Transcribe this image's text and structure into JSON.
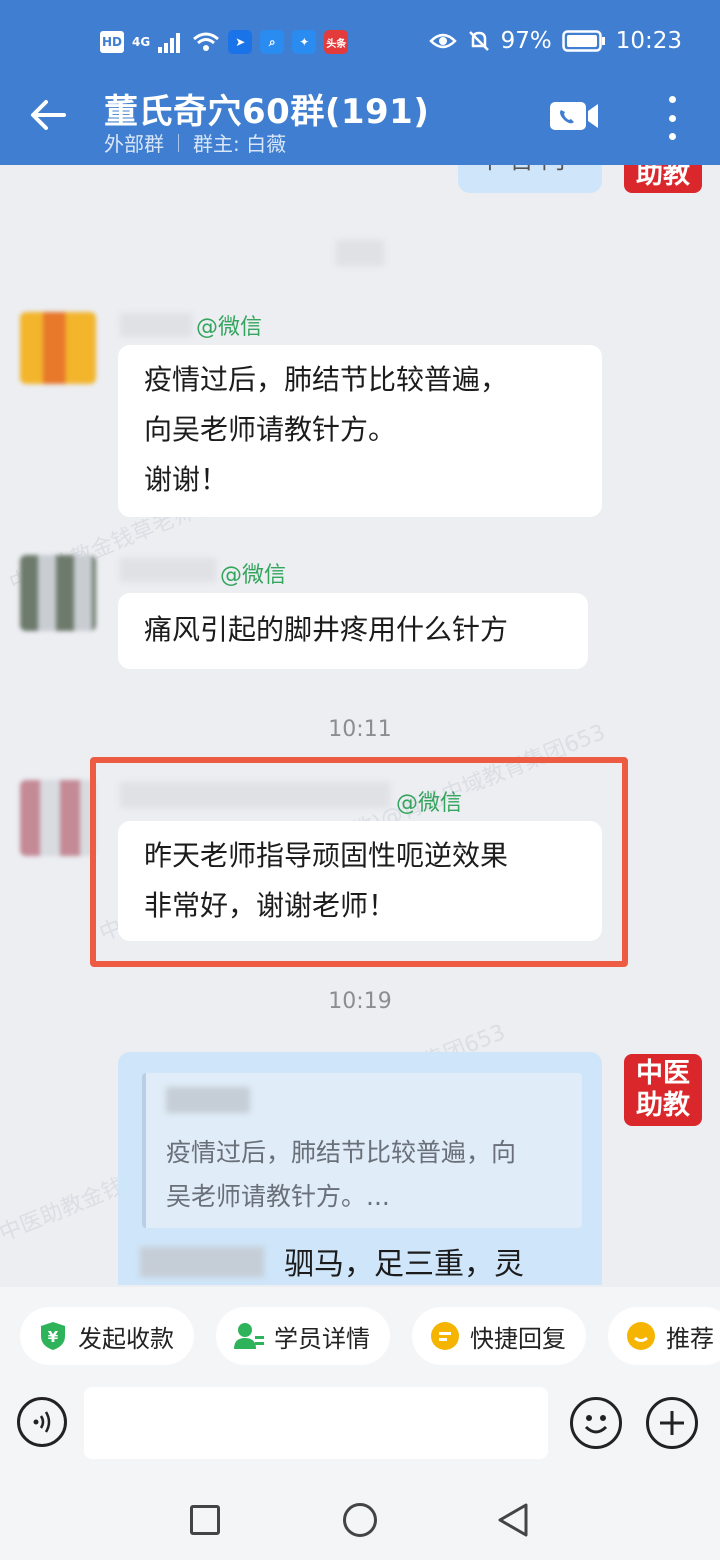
{
  "status_bar": {
    "network_labels": [
      "HD",
      "4G"
    ],
    "app_icon_labels": [
      "头条"
    ],
    "battery": "97%",
    "time": "10:23"
  },
  "header": {
    "title": "董氏奇穴60群(191)",
    "group_type": "外部群",
    "owner": "群主: 白薇"
  },
  "chat": {
    "top_partial_text": "半 首 门",
    "messages": [
      {
        "sender_tag": "@微信",
        "lines": [
          "疫情过后，肺结节比较普遍，",
          "向吴老师请教针方。",
          "谢谢！"
        ]
      },
      {
        "sender_tag": "@微信",
        "lines": [
          "痛风引起的脚井疼用什么针方"
        ]
      },
      {
        "time": "10:11"
      },
      {
        "sender_tag": "@微信",
        "lines": [
          "昨天老师指导顽固性呃逆效果",
          "非常好，谢谢老师！"
        ]
      },
      {
        "time": "10:19"
      },
      {
        "quoted_lines": [
          "疫情过后，肺结节比较普遍，向",
          "吴老师请教针方。..."
        ],
        "reply_partial": "驷马，足三重，灵"
      }
    ],
    "badge_lines": [
      "中医",
      "助教"
    ],
    "watermark": "中医助教金钱草老师(中医助教)@青岛中域教育集团653"
  },
  "quick_actions": [
    {
      "label": "发起收款",
      "icon": "yen-shield-icon",
      "color": "#2fb35a"
    },
    {
      "label": "学员详情",
      "icon": "user-detail-icon",
      "color": "#2fb35a"
    },
    {
      "label": "快捷回复",
      "icon": "quick-reply-icon",
      "color": "#f4b400"
    },
    {
      "label": "推荐",
      "icon": "recommend-icon",
      "color": "#f4b400"
    }
  ],
  "colors": {
    "header": "#3f7ed0",
    "badge": "#d9272b",
    "highlight_border": "#ee5b43",
    "wechat_green": "#35a55e"
  }
}
